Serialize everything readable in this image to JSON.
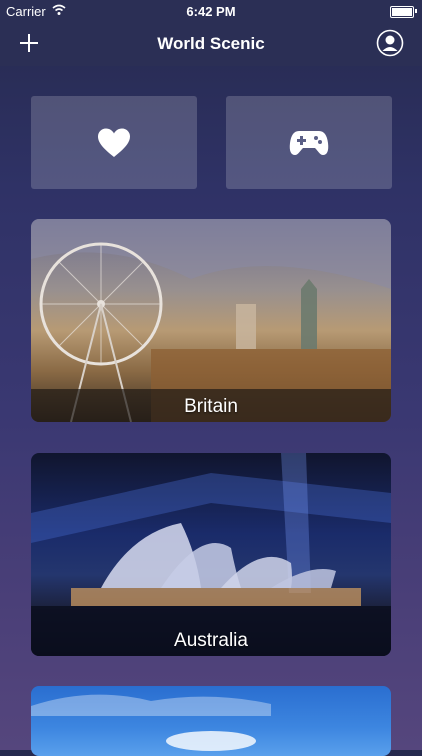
{
  "status_bar": {
    "carrier": "Carrier",
    "time": "6:42 PM"
  },
  "nav": {
    "title": "World Scenic",
    "left_icon": "plus-icon",
    "right_icon": "profile-icon"
  },
  "tiles": [
    {
      "icon": "heart-icon"
    },
    {
      "icon": "gamepad-icon"
    }
  ],
  "cards": [
    {
      "label": "Britain"
    },
    {
      "label": "Australia"
    },
    {
      "label": ""
    }
  ],
  "colors": {
    "nav_background": "#2b2f55",
    "tile_background": "rgba(255,255,255,0.18)"
  }
}
